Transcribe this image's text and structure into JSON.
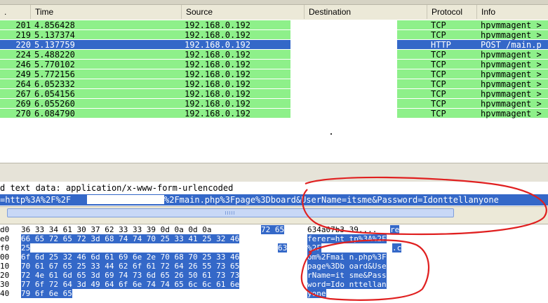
{
  "columns": [
    ".",
    "Time",
    "Source",
    "Destination",
    "Protocol",
    "Info"
  ],
  "packets": [
    {
      "no": "201",
      "time": "4.856428",
      "src": "192.168.0.192",
      "proto": "TCP",
      "info": "hpvmmagent >"
    },
    {
      "no": "219",
      "time": "5.137374",
      "src": "192.168.0.192",
      "proto": "TCP",
      "info": "hpvmmagent >"
    },
    {
      "no": "220",
      "time": "5.137759",
      "src": "192.168.0.192",
      "proto": "HTTP",
      "info": "POST /main.p",
      "selected": true
    },
    {
      "no": "224",
      "time": "5.488220",
      "src": "192.168.0.192",
      "proto": "TCP",
      "info": "hpvmmagent >"
    },
    {
      "no": "246",
      "time": "5.770102",
      "src": "192.168.0.192",
      "proto": "TCP",
      "info": "hpvmmagent >"
    },
    {
      "no": "249",
      "time": "5.772156",
      "src": "192.168.0.192",
      "proto": "TCP",
      "info": "hpvmmagent >"
    },
    {
      "no": "264",
      "time": "6.052332",
      "src": "192.168.0.192",
      "proto": "TCP",
      "info": "hpvmmagent >"
    },
    {
      "no": "267",
      "time": "6.054156",
      "src": "192.168.0.192",
      "proto": "TCP",
      "info": "hpvmmagent >"
    },
    {
      "no": "269",
      "time": "6.055260",
      "src": "192.168.0.192",
      "proto": "TCP",
      "info": "hpvmmagent >"
    },
    {
      "no": "270",
      "time": "6.084790",
      "src": "192.168.0.192",
      "proto": "TCP",
      "info": "hpvmmagent >"
    }
  ],
  "details": {
    "encoded_text": "d text data: application/x-www-form-urlencoded",
    "form_prefix": "=http%3A%2F%2F",
    "form_suffix": "%2Fmain.php%3Fpage%3Dboard&UserName=itsme&Password=Idonttellanyone"
  },
  "hex_rows": [
    {
      "off": "d0",
      "bytes": "36 33 34 61 30 37 62 33  33 39 0d 0a 0d 0a",
      "sel_bytes": "72 65",
      "ascii": "634a07b3 39....",
      "sel_ascii": "re"
    },
    {
      "off": "e0",
      "sel_bytes": "66 65 72 65 72 3d 68 74  74 70 25 33 41 25 32 46",
      "sel_ascii": "ferer=ht tp%3A%2F"
    },
    {
      "off": "f0",
      "sel_bytes": "25",
      "sel_bytes_end": "63",
      "sel_ascii": "%2F",
      "sel_ascii_end": ".c"
    },
    {
      "off": "00",
      "sel_bytes": "6f 6d 25 32 46 6d 61 69  6e 2e 70 68 70 25 33 46",
      "sel_ascii": "om%2Fmai n.php%3F"
    },
    {
      "off": "10",
      "sel_bytes": "70 61 67 65 25 33 44 62  6f 61 72 64 26 55 73 65",
      "sel_ascii": "page%3Db oard&Use"
    },
    {
      "off": "20",
      "sel_bytes": "72 4e 61 6d 65 3d 69 74  73 6d 65 26 50 61 73 73",
      "sel_ascii": "rName=it sme&Pass"
    },
    {
      "off": "30",
      "sel_bytes": "77 6f 72 64 3d 49 64 6f  6e 74 74 65 6c 6c 61 6e",
      "sel_ascii": "word=Ido nttellan"
    },
    {
      "off": "40",
      "sel_bytes": "79 6f 6e 65",
      "sel_ascii": "yone"
    }
  ],
  "colors": {
    "row_bg": "#8ef08a",
    "selection": "#3468c8",
    "annotation": "#e02020"
  }
}
